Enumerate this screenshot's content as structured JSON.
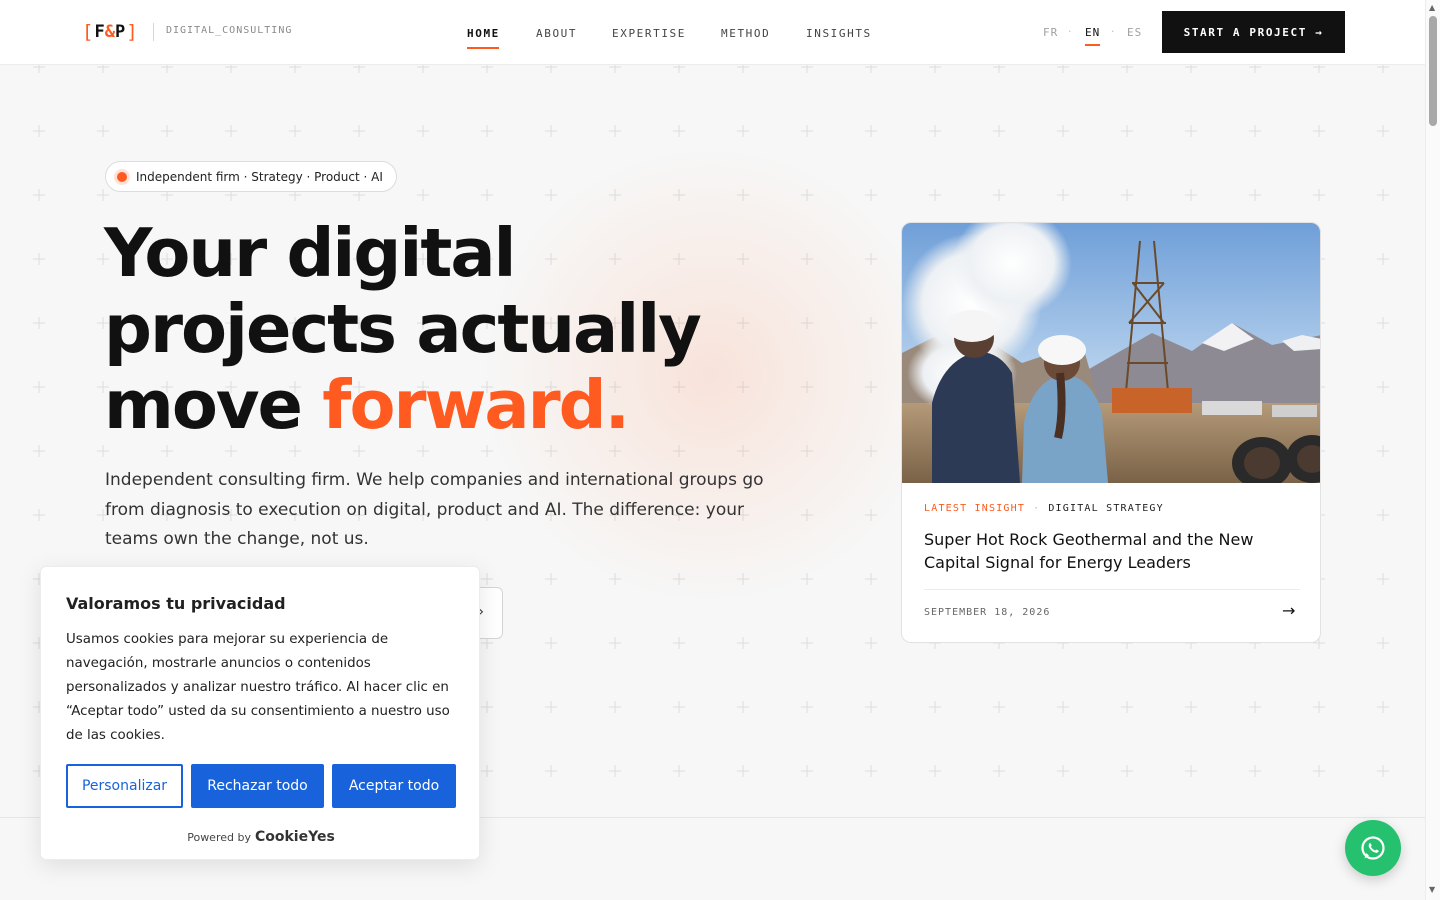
{
  "header": {
    "logo_left_bracket": "[",
    "logo_f": "F",
    "logo_amp": "&",
    "logo_p": "P",
    "logo_right_bracket": "]",
    "tagline": "DIGITAL_CONSULTING",
    "nav": [
      {
        "label": "HOME",
        "active": true
      },
      {
        "label": "ABOUT"
      },
      {
        "label": "EXPERTISE"
      },
      {
        "label": "METHOD"
      },
      {
        "label": "INSIGHTS"
      }
    ],
    "languages": [
      {
        "label": "FR"
      },
      {
        "label": "EN",
        "active": true
      },
      {
        "label": "ES"
      }
    ],
    "lang_separator": "·",
    "cta_label": "START A PROJECT →"
  },
  "hero": {
    "badge": "Independent firm · Strategy · Product · AI",
    "headline_line1": "Your digital",
    "headline_line2": "projects actually",
    "headline_line3_plain": "move ",
    "headline_line3_accent": "forward.",
    "lead": "Independent consulting firm. We help companies and international groups go from diagnosis to execution on digital, product and AI. The difference: your teams own the change, not us."
  },
  "card": {
    "label_primary": "LATEST INSIGHT",
    "label_separator": "·",
    "label_secondary": "DIGITAL STRATEGY",
    "title": "Super Hot Rock Geothermal and the New Capital Signal for Energy Leaders",
    "date": "SEPTEMBER 18, 2026",
    "arrow": "→"
  },
  "cookie": {
    "title": "Valoramos tu privacidad",
    "text": "Usamos cookies para mejorar su experiencia de navegación, mostrarle anuncios o contenidos personalizados y analizar nuestro tráfico. Al hacer clic en “Aceptar todo” usted da su consentimiento a nuestro uso de las cookies.",
    "customize_label": "Personalizar",
    "reject_label": "Rechazar todo",
    "accept_label": "Aceptar todo",
    "powered_by": "Powered by",
    "powered_brand": "CookieYes"
  },
  "widgets": {
    "whatsapp_icon": "whatsapp-icon"
  },
  "colors": {
    "accent": "#ff5a1f",
    "dark": "#111111",
    "cookie_blue": "#1863dc",
    "whatsapp_green": "#25c16f"
  }
}
